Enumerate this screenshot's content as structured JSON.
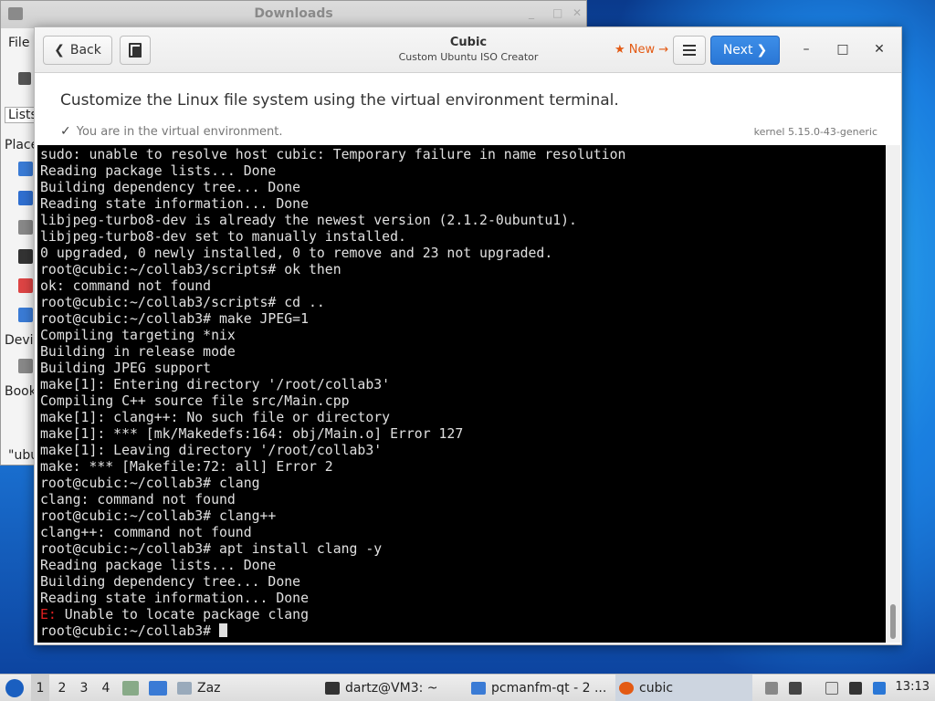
{
  "file_manager": {
    "title": "Downloads",
    "menu_file": "File",
    "lists_label": "Lists",
    "places_label": "Places",
    "devices_label": "Devic",
    "bookmarks_label": "Book",
    "bottom_text": "\"ubu"
  },
  "cubic": {
    "back_label": "Back",
    "next_label": "Next",
    "title": "Cubic",
    "subtitle": "Custom Ubuntu ISO Creator",
    "new_label": "★ New →",
    "page_heading": "Customize the Linux file system using the virtual environment terminal.",
    "status": "You are in the virtual environment.",
    "kernel": "kernel 5.15.0-43-generic"
  },
  "terminal": {
    "lines": [
      "sudo: unable to resolve host cubic: Temporary failure in name resolution",
      "Reading package lists... Done",
      "Building dependency tree... Done",
      "Reading state information... Done",
      "libjpeg-turbo8-dev is already the newest version (2.1.2-0ubuntu1).",
      "libjpeg-turbo8-dev set to manually installed.",
      "0 upgraded, 0 newly installed, 0 to remove and 23 not upgraded.",
      "root@cubic:~/collab3/scripts# ok then",
      "ok: command not found",
      "root@cubic:~/collab3/scripts# cd ..",
      "root@cubic:~/collab3# make JPEG=1",
      "Compiling targeting *nix",
      "Building in release mode",
      "Building JPEG support",
      "make[1]: Entering directory '/root/collab3'",
      "Compiling C++ source file src/Main.cpp",
      "make[1]: clang++: No such file or directory",
      "make[1]: *** [mk/Makedefs:164: obj/Main.o] Error 127",
      "make[1]: Leaving directory '/root/collab3'",
      "make: *** [Makefile:72: all] Error 2",
      "root@cubic:~/collab3# clang",
      "clang: command not found",
      "root@cubic:~/collab3# clang++",
      "clang++: command not found",
      "root@cubic:~/collab3# apt install clang -y",
      "Reading package lists... Done",
      "Building dependency tree... Done",
      "Reading state information... Done"
    ],
    "error_prefix": "E:",
    "error_text": " Unable to locate package clang",
    "prompt": "root@cubic:~/collab3# "
  },
  "taskbar": {
    "workspaces": [
      "1",
      "2",
      "3",
      "4"
    ],
    "folder_label": "Zaz",
    "tasks": [
      {
        "label": "dartz@VM3: ~"
      },
      {
        "label": "pcmanfm-qt - 2 ..."
      },
      {
        "label": "cubic"
      }
    ],
    "clock": "13:13"
  },
  "colors": {
    "accent": "#2a77d6",
    "new_link": "#e35a14",
    "terminal_bg": "#000000",
    "terminal_error": "#e02020"
  }
}
